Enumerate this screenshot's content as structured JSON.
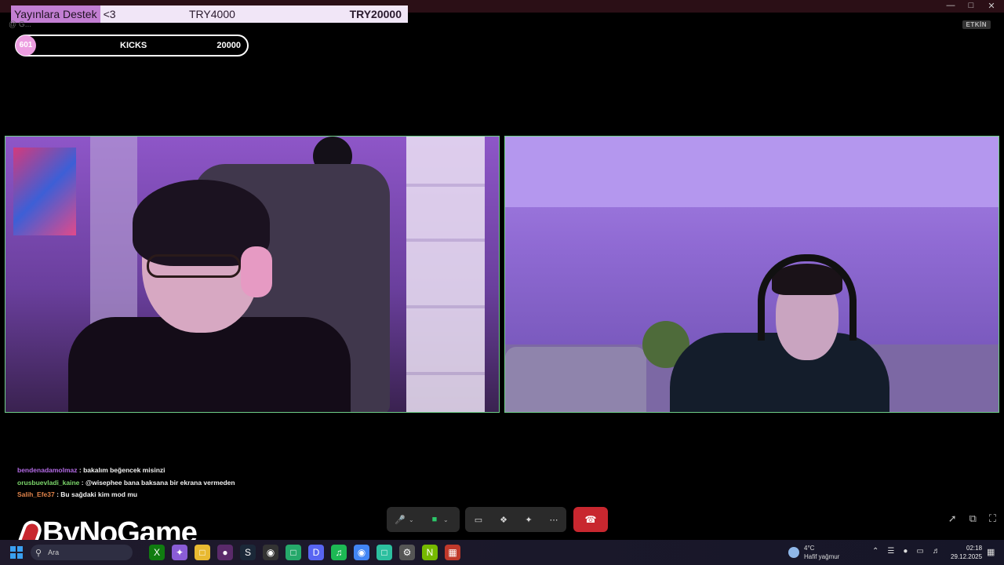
{
  "donation": {
    "label": "Yayınlara Destek",
    "heart": "<3",
    "current": "TRY4000",
    "goal": "TRY20000"
  },
  "connection_text": "@  G...",
  "kicks": {
    "count": "601",
    "label": "KICKS",
    "goal": "20000"
  },
  "status_badge": "ETKİN",
  "chat": [
    {
      "user": "bendenadamolmaz",
      "user_color": "#b46be6",
      "message": "bakalım beğencek misinzi"
    },
    {
      "user": "orusbuevladi_kaine",
      "user_color": "#7bd66a",
      "message": "@wisephee bana baksana bir ekrana vermeden"
    },
    {
      "user": "Salih_Efe37",
      "user_color": "#e0834a",
      "message": "Bu sağdaki kim mod mu"
    }
  ],
  "logo": "ByNoGame",
  "taskbar": {
    "search_placeholder": "Ara",
    "weather_temp": "4°C",
    "weather_desc": "Hafif yağmur",
    "time": "02:18",
    "date": "29.12.2025"
  },
  "colors": {
    "accent_green": "#6fcf88",
    "hangup_red": "#c8272f",
    "kicks_pink": "#ec9de0"
  },
  "icons": [
    "mic-icon",
    "camera-icon",
    "share-screen-icon",
    "apps-icon",
    "effects-icon",
    "more-icon",
    "hangup-icon",
    "pin-icon",
    "expand-icon",
    "fullscreen-icon"
  ]
}
